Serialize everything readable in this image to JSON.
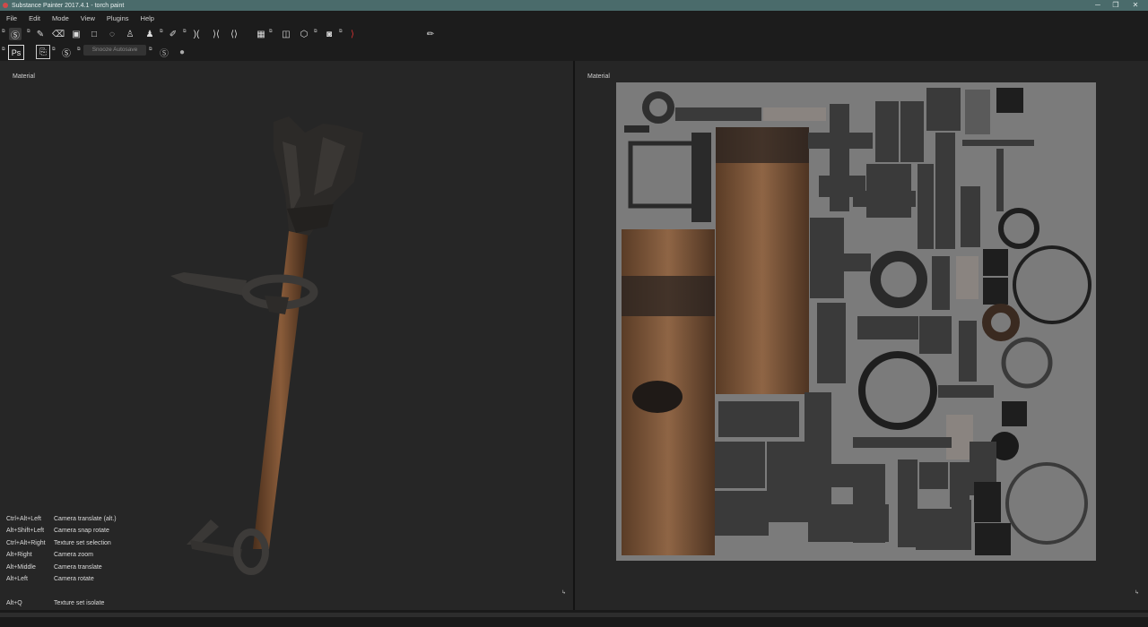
{
  "window": {
    "title": "Substance Painter 2017.4.1 - torch paint",
    "controls": [
      "─",
      "❐",
      "✕"
    ]
  },
  "menu": [
    "File",
    "Edit",
    "Mode",
    "View",
    "Plugins",
    "Help"
  ],
  "toolbar": {
    "size_value": "8",
    "autosave_label": "Snooze Autosave",
    "ps_label": "Ps"
  },
  "viewports": {
    "left_label": "Material",
    "right_label": "Material"
  },
  "shortcuts": [
    {
      "keys": "Ctrl+Alt+Left",
      "action": "Camera translate (alt.)"
    },
    {
      "keys": "Alt+Shift+Left",
      "action": "Camera snap rotate"
    },
    {
      "keys": "Ctrl+Alt+Right",
      "action": "Texture set selection"
    },
    {
      "keys": "Alt+Right",
      "action": "Camera zoom"
    },
    {
      "keys": "Alt+Middle",
      "action": "Camera translate"
    },
    {
      "keys": "Alt+Left",
      "action": "Camera rotate"
    },
    {
      "keys": "",
      "action": ""
    },
    {
      "keys": "Alt+Q",
      "action": "Texture set isolate"
    }
  ],
  "colors": {
    "accent": "#4a6b6b",
    "background": "#262626",
    "uv_background": "#7b7b7b"
  }
}
